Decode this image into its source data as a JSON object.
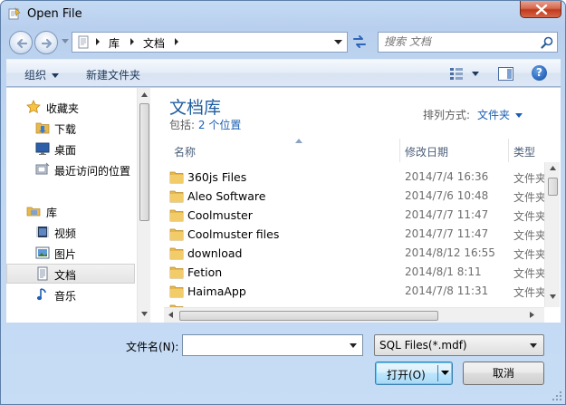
{
  "window": {
    "title": "Open File"
  },
  "address": {
    "segments": [
      "库",
      "文档"
    ]
  },
  "search": {
    "placeholder": "搜索 文档"
  },
  "toolbar": {
    "organize": "组织",
    "new_folder": "新建文件夹"
  },
  "sidebar": {
    "favorites": {
      "label": "收藏夹",
      "items": [
        {
          "label": "下载",
          "icon": "download-folder-icon"
        },
        {
          "label": "桌面",
          "icon": "desktop-icon"
        },
        {
          "label": "最近访问的位置",
          "icon": "recent-places-icon"
        }
      ]
    },
    "libraries": {
      "label": "库",
      "items": [
        {
          "label": "视频",
          "icon": "video-library-icon"
        },
        {
          "label": "图片",
          "icon": "pictures-library-icon"
        },
        {
          "label": "文档",
          "icon": "documents-library-icon",
          "selected": true
        },
        {
          "label": "音乐",
          "icon": "music-library-icon"
        }
      ]
    }
  },
  "library": {
    "title": "文档库",
    "includes_label": "包括:",
    "includes_link": "2 个位置",
    "arrange_label": "排列方式:",
    "arrange_value": "文件夹"
  },
  "columns": {
    "name": "名称",
    "modified": "修改日期",
    "type": "类型"
  },
  "files": [
    {
      "name": "360js Files",
      "modified": "2014/7/4 16:36",
      "type": "文件夹"
    },
    {
      "name": "Aleo Software",
      "modified": "2014/7/6 10:48",
      "type": "文件夹"
    },
    {
      "name": "Coolmuster",
      "modified": "2014/7/7 11:47",
      "type": "文件夹"
    },
    {
      "name": "Coolmuster files",
      "modified": "2014/7/7 11:47",
      "type": "文件夹"
    },
    {
      "name": "download",
      "modified": "2014/8/12 16:55",
      "type": "文件夹"
    },
    {
      "name": "Fetion",
      "modified": "2014/8/1 8:11",
      "type": "文件夹"
    },
    {
      "name": "HaimaApp",
      "modified": "2014/7/8 11:31",
      "type": "文件夹"
    }
  ],
  "footer": {
    "filename_label": "文件名(N):",
    "filename_value": "",
    "filter_value": "SQL Files(*.mdf)",
    "open_label": "打开(O)",
    "cancel_label": "取消"
  },
  "colors": {
    "accent_link": "#1b5fb3",
    "library_title": "#1e5d9e",
    "folder": "#e8b84a"
  }
}
